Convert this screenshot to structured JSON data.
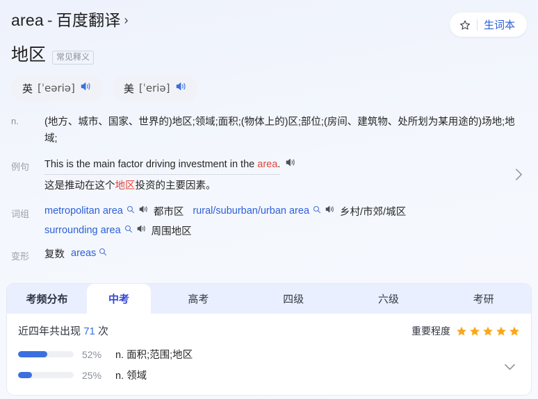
{
  "header": {
    "title_word": "area",
    "title_sep": "-",
    "title_source": "百度翻译",
    "title_chevron": "›",
    "vocab_button_label": "生词本",
    "star_icon": "star-outline-icon"
  },
  "word": {
    "headword_cn": "地区",
    "tag": "常见释义"
  },
  "phonetics": [
    {
      "lang": "英",
      "ipa": "[ˈeəriə]",
      "speaker_icon": "speaker-icon"
    },
    {
      "lang": "美",
      "ipa": "[ˈeriə]",
      "speaker_icon": "speaker-icon"
    }
  ],
  "definition": {
    "pos": "n.",
    "text": "(地方、城市、国家、世界的)地区;领域;面积;(物体上的)区;部位;(房间、建筑物、处所划为某用途的)场地;地域;"
  },
  "example": {
    "label": "例句",
    "en_before": "This is the main factor driving investment in the ",
    "en_keyword": "area",
    "en_after": ".",
    "speaker_icon": "speaker-icon",
    "zh_before": "这是推动在这个",
    "zh_keyword": "地区",
    "zh_after": "投资的主要因素。",
    "next_icon": "chevron-right-icon"
  },
  "phrases": {
    "label": "词组",
    "items": [
      {
        "en": "metropolitan area",
        "zh": "都市区",
        "search_icon": "search-icon",
        "speaker_icon": "speaker-icon"
      },
      {
        "en": "rural/suburban/urban area",
        "zh": "乡村/市郊/城区",
        "search_icon": "search-icon",
        "speaker_icon": "speaker-icon"
      },
      {
        "en": "surrounding area",
        "zh": "周围地区",
        "search_icon": "search-icon",
        "speaker_icon": "speaker-icon"
      }
    ]
  },
  "inflection": {
    "label": "变形",
    "kind": "复数",
    "value": "areas",
    "search_icon": "search-icon"
  },
  "exam_card": {
    "tabs": [
      {
        "label": "考频分布",
        "type": "head"
      },
      {
        "label": "中考",
        "type": "active"
      },
      {
        "label": "高考",
        "type": "normal"
      },
      {
        "label": "四级",
        "type": "normal"
      },
      {
        "label": "六级",
        "type": "normal"
      },
      {
        "label": "考研",
        "type": "normal"
      }
    ],
    "stat_prefix": "近四年共出现",
    "stat_count": "71",
    "stat_suffix": "次",
    "importance_label": "重要程度",
    "stars_filled": 5,
    "bars": [
      {
        "pct_label": "52%",
        "pct_value": 52,
        "text": "n. 面积;范围;地区"
      },
      {
        "pct_label": "25%",
        "pct_value": 25,
        "text": "n. 领域"
      }
    ],
    "expand_icon": "chevron-down-icon"
  },
  "colors": {
    "link_blue": "#2b5fd9",
    "accent_blue": "#3b6fe0",
    "tab_active_blue": "#3246d6",
    "keyword_red": "#e3453b",
    "star_gold": "#f9a81a",
    "tab_bg": "#eaefff"
  }
}
